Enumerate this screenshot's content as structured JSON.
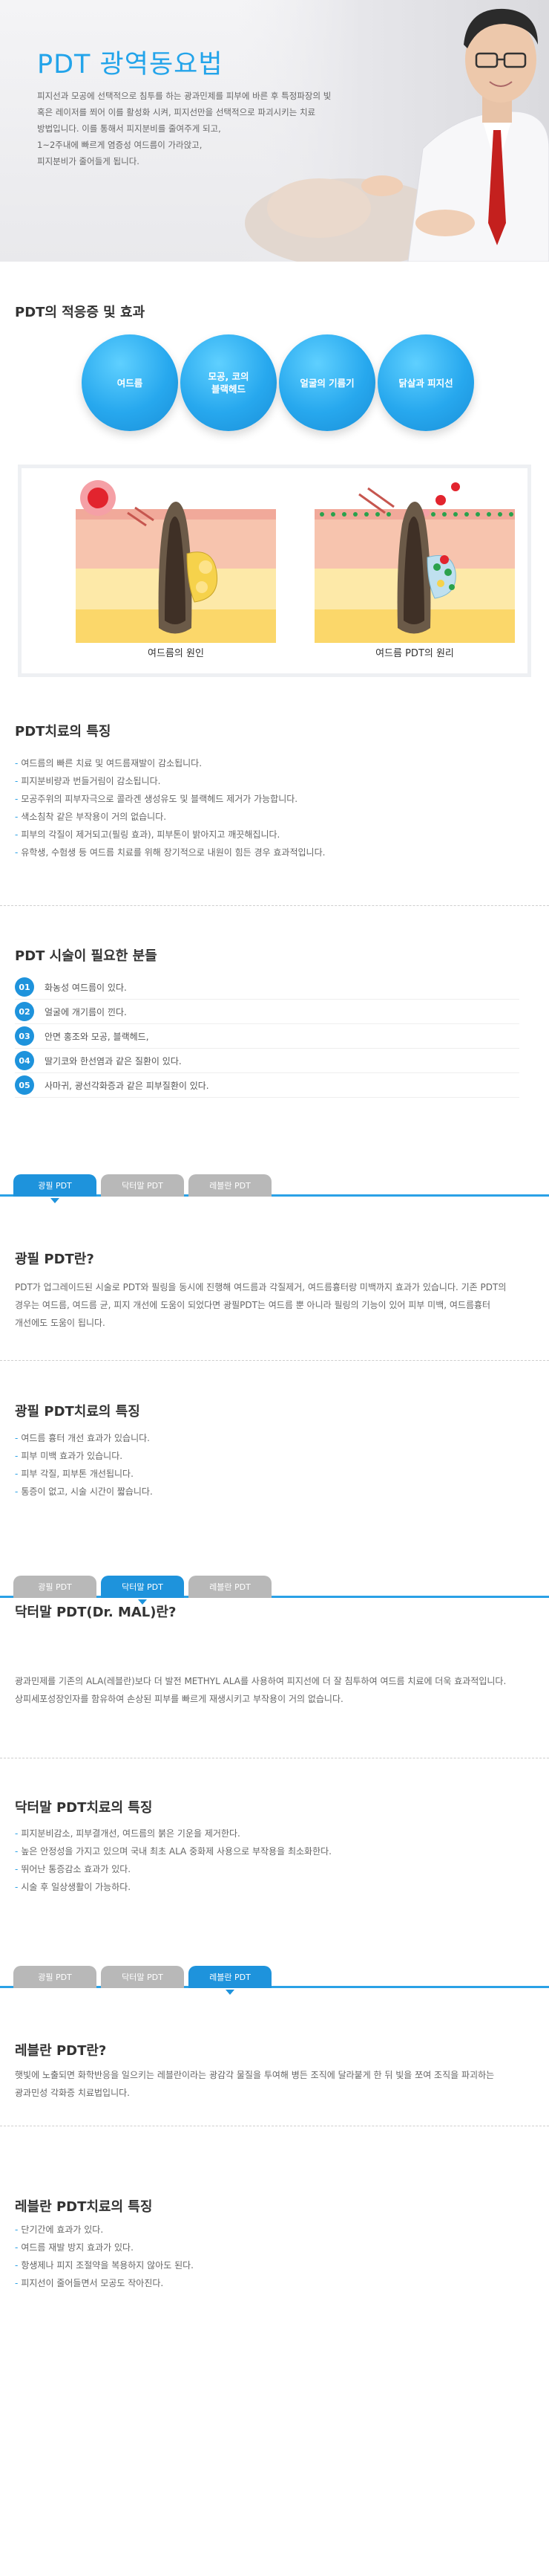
{
  "hero": {
    "title": "PDT 광역동요법",
    "desc": [
      "피지선과 모공에 선택적으로 침투를 하는 광과민제를 피부에 바른 후 특정파장의 빛",
      "혹은 레이저를 쬐어 이를 활성화 시켜, 피지선만을 선택적으로 파괴시키는 치료",
      "방법입니다. 이를 통해서 피지분비를 줄여주게 되고,",
      "1~2주내에 빠르게 염증성 여드름이 가라앉고,",
      "피지분비가 줄어들게 됩니다."
    ]
  },
  "indications": {
    "title": "PDT의 적응증 및 효과",
    "circles": [
      "여드름",
      "모공, 코의\n블랙헤드",
      "얼굴의 기름기",
      "닭살과 피지선"
    ],
    "captions": [
      "여드름의 원인",
      "여드름 PDT의 원리"
    ]
  },
  "features": {
    "title": "PDT치료의 특징",
    "items": [
      "여드름의 빠른 치료 및 여드름재발이 감소됩니다.",
      "피지분비량과 번들거림이 감소됩니다.",
      "모공주위의 피부자극으로 콜라겐 생성유도 및 블랙헤드 제거가 가능합니다.",
      "색소침착 같은 부작용이 거의 없습니다.",
      "피부의 각질이 제거되고(필링 효과), 피부톤이 밝아지고 깨끗해집니다.",
      "유학생, 수험생 등 여드름 치료를 위해 장기적으로 내원이 힘든 경우 효과적입니다."
    ]
  },
  "needs": {
    "title": "PDT 시술이 필요한 분들",
    "items": [
      {
        "num": "01",
        "text": "화농성 여드름이 있다."
      },
      {
        "num": "02",
        "text": "얼굴에 개기름이 낀다."
      },
      {
        "num": "03",
        "text": "안면 홍조와 모공, 블랙헤드,"
      },
      {
        "num": "04",
        "text": "딸기코와 한선염과 같은 질환이 있다."
      },
      {
        "num": "05",
        "text": "사마귀, 광선각화증과 같은 피부질환이 있다."
      }
    ]
  },
  "tabs": [
    "광필 PDT",
    "닥터말 PDT",
    "레블란 PDT"
  ],
  "kwangpil": {
    "what_title": "광필 PDT란?",
    "what_desc": [
      "PDT가 업그레이드된 시술로 PDT와 필링을 동시에 진행해 여드름과 각질제거, 여드름흉터랑 미백까지 효과가 있습니다. 기존 PDT의",
      "경우는 여드름, 여드름 균, 피지 개선에 도움이 되었다면 광필PDT는 여드름 뿐 아니라 필링의 기능이 있어 피부 미백, 여드름흉터",
      "개선에도 도움이 됩니다."
    ],
    "feat_title": "광필 PDT치료의 특징",
    "feat_items": [
      "여드름 흉터 개선 효과가 있습니다.",
      "피부 미백 효과가 있습니다.",
      "피부 각질, 피부톤 개선됩니다.",
      "통증이 없고, 시술 시간이 짧습니다."
    ]
  },
  "drmal": {
    "what_title": "닥터말 PDT(Dr. MAL)란?",
    "what_desc": [
      "광과민제를 기존의 ALA(레블란)보다 더 발전 METHYL ALA를 사용하여 피지선에 더 잘 침투하여 여드름 치료에 더욱 효과적입니다.",
      "상피세포성장인자를 함유하여 손상된 피부를 빠르게 재생시키고 부작용이 거의 없습니다."
    ],
    "feat_title": "닥터말 PDT치료의 특징",
    "feat_items": [
      "피지분비감소, 피부결개선, 여드름의 붉은 기운을 제거한다.",
      "높은 안정성을 가지고 있으며 국내 최초 ALA 중화제 사용으로 부작용을 최소화한다.",
      "뛰어난 통증감소 효과가 있다.",
      "시술 후 일상생활이 가능하다."
    ]
  },
  "levulan": {
    "what_title": "레블란 PDT란?",
    "what_desc": [
      "햇빛에 노출되면 화학반응을 일으키는 레블란이라는 광감각 물질을 투여해 병든 조직에 달라붙게 한 뒤 빛을 쪼여 조직을 파괴하는",
      "광과민성 각화증 치료법입니다."
    ],
    "feat_title": "레블란 PDT치료의 특징",
    "feat_items": [
      "단기간에 효과가 있다.",
      "여드름 재발 방지 효과가 있다.",
      "항생제나 피지 조절약을 복용하지 않아도 된다.",
      "피지선이 줄어들면서 모공도 작아진다."
    ]
  },
  "colors": {
    "accent": "#2aa1e6",
    "tab_active": "#1e93dc",
    "tab_inactive": "#b8b8b8"
  }
}
